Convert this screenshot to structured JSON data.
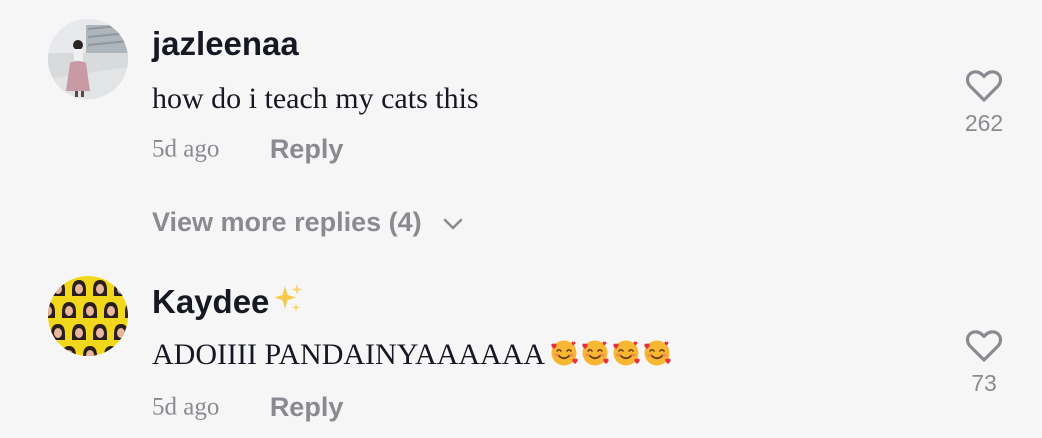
{
  "comments": [
    {
      "username": "jazleenaa",
      "text": "how do i teach my cats this",
      "time": "5d ago",
      "reply_label": "Reply",
      "likes": "262",
      "avatar_icon": "profile-photo-person-outdoors"
    },
    {
      "username": "Kaydee",
      "username_decoration_icon": "sparkles-emoji",
      "text": "ADOIIII PANDAINYAAAAAA",
      "emojis": [
        "smiling-face-with-hearts",
        "smiling-face-with-hearts",
        "smiling-face-with-hearts",
        "smiling-face-with-hearts"
      ],
      "time": "5d ago",
      "reply_label": "Reply",
      "likes": "73",
      "avatar_icon": "profile-photo-yellow-pattern"
    }
  ],
  "view_more": {
    "label": "View more replies (4)",
    "icon": "chevron-down-icon"
  },
  "colors": {
    "background": "#f6f6f6",
    "primary_text": "#161823",
    "secondary_text": "#8a8b91",
    "avatar_yellow": "#f2d81c"
  }
}
